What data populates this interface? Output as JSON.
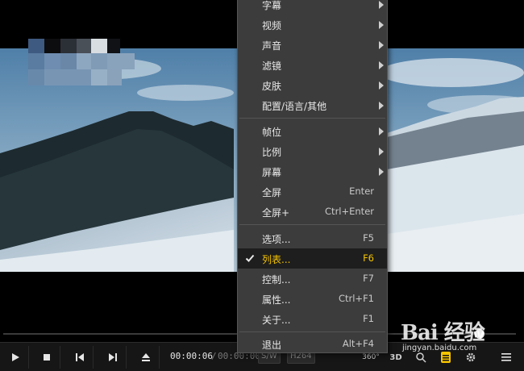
{
  "menu": {
    "items": [
      {
        "label": "字幕",
        "shortcut": "",
        "submenu": true
      },
      {
        "label": "视频",
        "shortcut": "",
        "submenu": true
      },
      {
        "label": "声音",
        "shortcut": "",
        "submenu": true
      },
      {
        "label": "滤镜",
        "shortcut": "",
        "submenu": true
      },
      {
        "label": "皮肤",
        "shortcut": "",
        "submenu": true
      },
      {
        "label": "配置/语言/其他",
        "shortcut": "",
        "submenu": true
      },
      {
        "label": "帧位",
        "shortcut": "",
        "submenu": true
      },
      {
        "label": "比例",
        "shortcut": "",
        "submenu": true
      },
      {
        "label": "屏幕",
        "shortcut": "",
        "submenu": true
      },
      {
        "label": "全屏",
        "shortcut": "Enter",
        "submenu": false
      },
      {
        "label": "全屏+",
        "shortcut": "Ctrl+Enter",
        "submenu": false
      },
      {
        "label": "选项...",
        "shortcut": "F5",
        "submenu": false
      },
      {
        "label": "列表...",
        "shortcut": "F6",
        "submenu": false,
        "checked": true
      },
      {
        "label": "控制...",
        "shortcut": "F7",
        "submenu": false
      },
      {
        "label": "属性...",
        "shortcut": "Ctrl+F1",
        "submenu": false
      },
      {
        "label": "关于...",
        "shortcut": "F1",
        "submenu": false
      },
      {
        "label": "退出",
        "shortcut": "Alt+F4",
        "submenu": false
      }
    ]
  },
  "player": {
    "current_time": "00:00:06",
    "separator": "/",
    "total_time": "00:00:00",
    "tag_sw": "S/W",
    "tag_codec": "H264",
    "btn_360": "360°",
    "btn_3d": "3D",
    "seek_progress": 0.93
  },
  "watermark": {
    "main": "Bai 经验",
    "sub": "jingyan.baidu.com"
  },
  "colors": {
    "accent": "#f5c400",
    "menu_bg": "#3c3c3c",
    "control_bg": "#161616"
  }
}
